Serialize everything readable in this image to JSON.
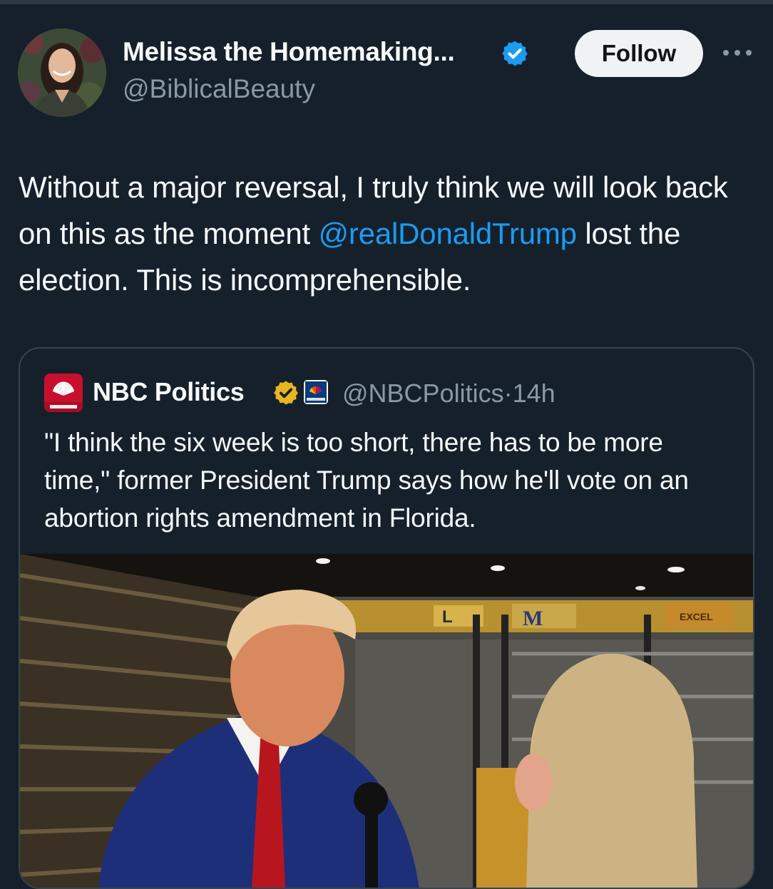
{
  "author": {
    "display_name": "Melissa the Homemaking...",
    "handle": "@BiblicalBeauty",
    "verified": "verified-blue-badge"
  },
  "actions": {
    "follow_label": "Follow",
    "more_icon": "more-horizontal-icon"
  },
  "tweet": {
    "text_before": "Without a major reversal, I truly think we will look back on this as the moment ",
    "mention": "@realDonaldTrump",
    "text_after": " lost the election. This is incomprehensible."
  },
  "quoted": {
    "display_name": "NBC Politics",
    "verified": "verified-gold-badge",
    "affiliate_icon": "nbc-news-affiliate-icon",
    "handle": "@NBCPolitics",
    "separator": "·",
    "time": "14h",
    "text": "\"I think the six week is too short, there has to be more time,\" former President Trump says how he'll vote on an abortion rights amendment in Florida.",
    "media_signs": [
      "L",
      "M",
      "EXCEL"
    ]
  },
  "colors": {
    "background": "#15202b",
    "text": "#f7f9f9",
    "secondary": "#8b98a5",
    "link": "#1d9bf0",
    "border": "#38444d",
    "follow_bg": "#eff3f4",
    "nbc_red": "#c8102e"
  }
}
